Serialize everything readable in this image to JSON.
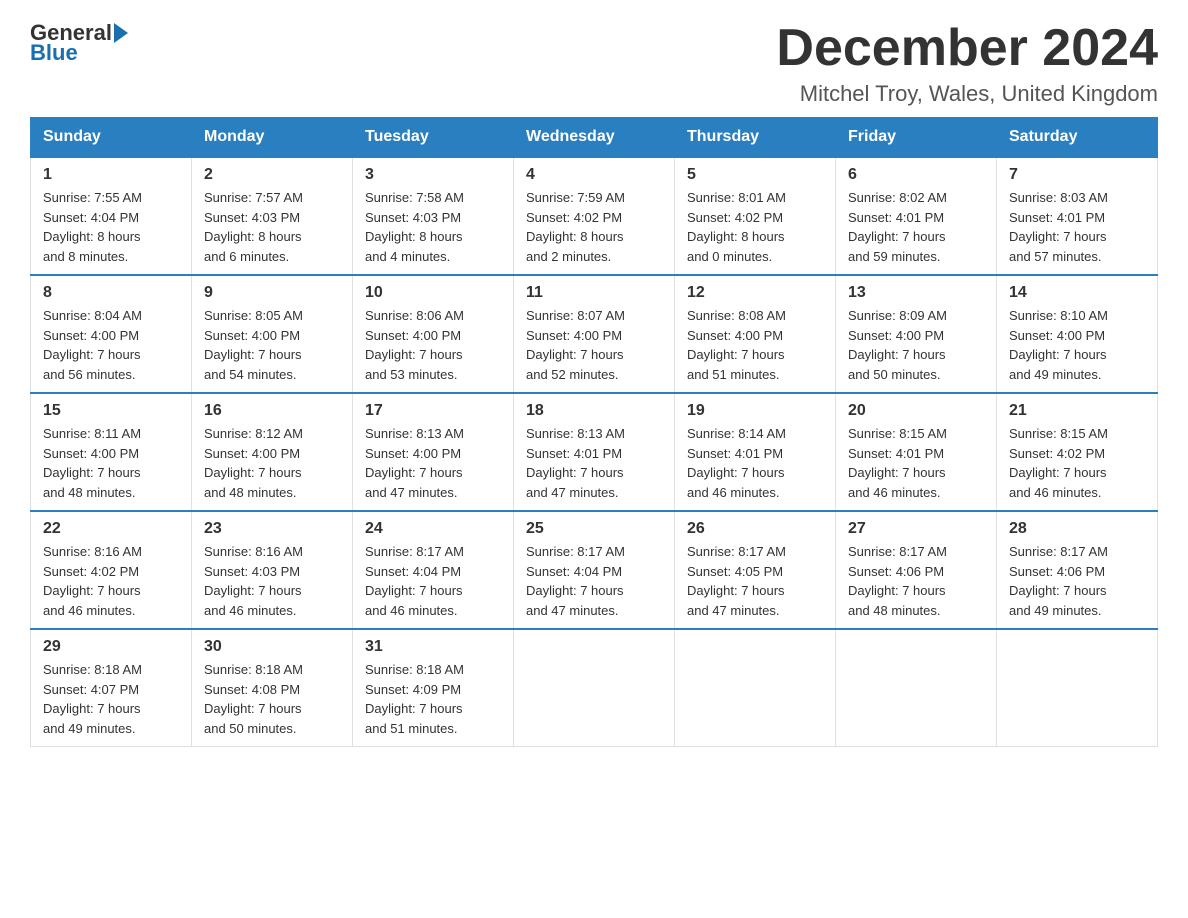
{
  "header": {
    "logo_general": "General",
    "logo_blue": "Blue",
    "month_title": "December 2024",
    "subtitle": "Mitchel Troy, Wales, United Kingdom"
  },
  "days_of_week": [
    "Sunday",
    "Monday",
    "Tuesday",
    "Wednesday",
    "Thursday",
    "Friday",
    "Saturday"
  ],
  "weeks": [
    [
      {
        "day": "1",
        "info": "Sunrise: 7:55 AM\nSunset: 4:04 PM\nDaylight: 8 hours\nand 8 minutes."
      },
      {
        "day": "2",
        "info": "Sunrise: 7:57 AM\nSunset: 4:03 PM\nDaylight: 8 hours\nand 6 minutes."
      },
      {
        "day": "3",
        "info": "Sunrise: 7:58 AM\nSunset: 4:03 PM\nDaylight: 8 hours\nand 4 minutes."
      },
      {
        "day": "4",
        "info": "Sunrise: 7:59 AM\nSunset: 4:02 PM\nDaylight: 8 hours\nand 2 minutes."
      },
      {
        "day": "5",
        "info": "Sunrise: 8:01 AM\nSunset: 4:02 PM\nDaylight: 8 hours\nand 0 minutes."
      },
      {
        "day": "6",
        "info": "Sunrise: 8:02 AM\nSunset: 4:01 PM\nDaylight: 7 hours\nand 59 minutes."
      },
      {
        "day": "7",
        "info": "Sunrise: 8:03 AM\nSunset: 4:01 PM\nDaylight: 7 hours\nand 57 minutes."
      }
    ],
    [
      {
        "day": "8",
        "info": "Sunrise: 8:04 AM\nSunset: 4:00 PM\nDaylight: 7 hours\nand 56 minutes."
      },
      {
        "day": "9",
        "info": "Sunrise: 8:05 AM\nSunset: 4:00 PM\nDaylight: 7 hours\nand 54 minutes."
      },
      {
        "day": "10",
        "info": "Sunrise: 8:06 AM\nSunset: 4:00 PM\nDaylight: 7 hours\nand 53 minutes."
      },
      {
        "day": "11",
        "info": "Sunrise: 8:07 AM\nSunset: 4:00 PM\nDaylight: 7 hours\nand 52 minutes."
      },
      {
        "day": "12",
        "info": "Sunrise: 8:08 AM\nSunset: 4:00 PM\nDaylight: 7 hours\nand 51 minutes."
      },
      {
        "day": "13",
        "info": "Sunrise: 8:09 AM\nSunset: 4:00 PM\nDaylight: 7 hours\nand 50 minutes."
      },
      {
        "day": "14",
        "info": "Sunrise: 8:10 AM\nSunset: 4:00 PM\nDaylight: 7 hours\nand 49 minutes."
      }
    ],
    [
      {
        "day": "15",
        "info": "Sunrise: 8:11 AM\nSunset: 4:00 PM\nDaylight: 7 hours\nand 48 minutes."
      },
      {
        "day": "16",
        "info": "Sunrise: 8:12 AM\nSunset: 4:00 PM\nDaylight: 7 hours\nand 48 minutes."
      },
      {
        "day": "17",
        "info": "Sunrise: 8:13 AM\nSunset: 4:00 PM\nDaylight: 7 hours\nand 47 minutes."
      },
      {
        "day": "18",
        "info": "Sunrise: 8:13 AM\nSunset: 4:01 PM\nDaylight: 7 hours\nand 47 minutes."
      },
      {
        "day": "19",
        "info": "Sunrise: 8:14 AM\nSunset: 4:01 PM\nDaylight: 7 hours\nand 46 minutes."
      },
      {
        "day": "20",
        "info": "Sunrise: 8:15 AM\nSunset: 4:01 PM\nDaylight: 7 hours\nand 46 minutes."
      },
      {
        "day": "21",
        "info": "Sunrise: 8:15 AM\nSunset: 4:02 PM\nDaylight: 7 hours\nand 46 minutes."
      }
    ],
    [
      {
        "day": "22",
        "info": "Sunrise: 8:16 AM\nSunset: 4:02 PM\nDaylight: 7 hours\nand 46 minutes."
      },
      {
        "day": "23",
        "info": "Sunrise: 8:16 AM\nSunset: 4:03 PM\nDaylight: 7 hours\nand 46 minutes."
      },
      {
        "day": "24",
        "info": "Sunrise: 8:17 AM\nSunset: 4:04 PM\nDaylight: 7 hours\nand 46 minutes."
      },
      {
        "day": "25",
        "info": "Sunrise: 8:17 AM\nSunset: 4:04 PM\nDaylight: 7 hours\nand 47 minutes."
      },
      {
        "day": "26",
        "info": "Sunrise: 8:17 AM\nSunset: 4:05 PM\nDaylight: 7 hours\nand 47 minutes."
      },
      {
        "day": "27",
        "info": "Sunrise: 8:17 AM\nSunset: 4:06 PM\nDaylight: 7 hours\nand 48 minutes."
      },
      {
        "day": "28",
        "info": "Sunrise: 8:17 AM\nSunset: 4:06 PM\nDaylight: 7 hours\nand 49 minutes."
      }
    ],
    [
      {
        "day": "29",
        "info": "Sunrise: 8:18 AM\nSunset: 4:07 PM\nDaylight: 7 hours\nand 49 minutes."
      },
      {
        "day": "30",
        "info": "Sunrise: 8:18 AM\nSunset: 4:08 PM\nDaylight: 7 hours\nand 50 minutes."
      },
      {
        "day": "31",
        "info": "Sunrise: 8:18 AM\nSunset: 4:09 PM\nDaylight: 7 hours\nand 51 minutes."
      },
      {
        "day": "",
        "info": ""
      },
      {
        "day": "",
        "info": ""
      },
      {
        "day": "",
        "info": ""
      },
      {
        "day": "",
        "info": ""
      }
    ]
  ]
}
